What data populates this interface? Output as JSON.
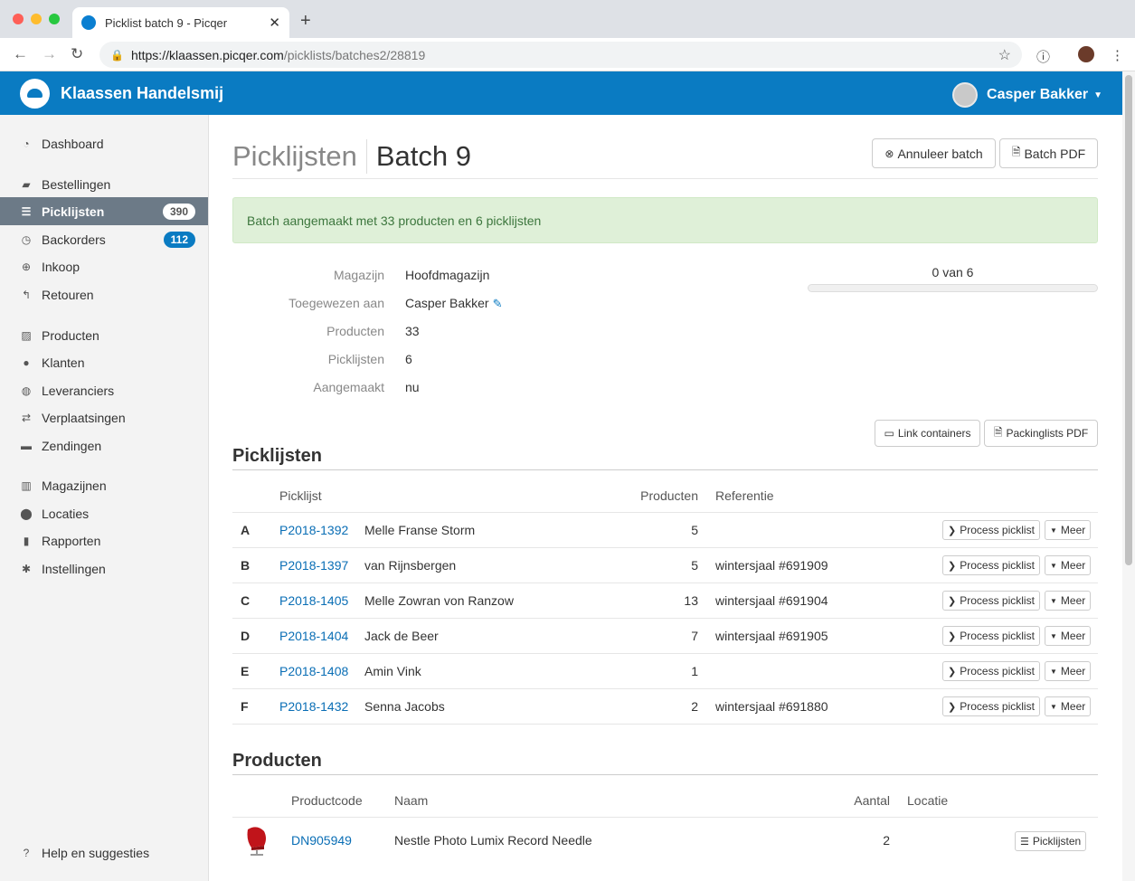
{
  "browser": {
    "tab_title": "Picklist batch 9 - Picqer",
    "url_host": "https://klaassen.picqer.com",
    "url_path": "/picklists/batches2/28819"
  },
  "header": {
    "company": "Klaassen Handelsmij",
    "user": "Casper Bakker"
  },
  "sidebar": {
    "items": [
      {
        "label": "Dashboard",
        "icon": "dashboard-icon",
        "glyph": "◔"
      },
      {
        "label": "Bestellingen",
        "icon": "cart-icon",
        "glyph": "▰"
      },
      {
        "label": "Picklijsten",
        "icon": "list-icon",
        "glyph": "☰",
        "badge": "390"
      },
      {
        "label": "Backorders",
        "icon": "clock-icon",
        "glyph": "◷",
        "badge": "112"
      },
      {
        "label": "Inkoop",
        "icon": "arrow-circle-icon",
        "glyph": "⊕"
      },
      {
        "label": "Retouren",
        "icon": "reply-icon",
        "glyph": "↰"
      },
      {
        "label": "Producten",
        "icon": "image-icon",
        "glyph": "▨"
      },
      {
        "label": "Klanten",
        "icon": "users-icon",
        "glyph": "●"
      },
      {
        "label": "Leveranciers",
        "icon": "globe-icon",
        "glyph": "◍"
      },
      {
        "label": "Verplaatsingen",
        "icon": "retweet-icon",
        "glyph": "⇄"
      },
      {
        "label": "Zendingen",
        "icon": "truck-icon",
        "glyph": "▬"
      },
      {
        "label": "Magazijnen",
        "icon": "building-icon",
        "glyph": "▥"
      },
      {
        "label": "Locaties",
        "icon": "map-marker-icon",
        "glyph": "⬤"
      },
      {
        "label": "Rapporten",
        "icon": "bar-chart-icon",
        "glyph": "▮"
      },
      {
        "label": "Instellingen",
        "icon": "cog-icon",
        "glyph": "✱"
      }
    ],
    "help": "Help en suggesties"
  },
  "page": {
    "title_parent": "Picklijsten",
    "title": "Batch 9",
    "cancel_button": "Annuleer batch",
    "pdf_button": "Batch PDF",
    "alert": "Batch aangemaakt met 33 producten en 6 picklijsten",
    "details": [
      {
        "label": "Magazijn",
        "value": "Hoofdmagazijn"
      },
      {
        "label": "Toegewezen aan",
        "value": "Casper Bakker"
      },
      {
        "label": "Producten",
        "value": "33"
      },
      {
        "label": "Picklijsten",
        "value": "6"
      },
      {
        "label": "Aangemaakt",
        "value": "nu"
      }
    ],
    "progress_text": "0 van 6",
    "progress_fraction": 0,
    "link_containers": "Link containers",
    "packinglists_pdf": "Packinglists PDF"
  },
  "picklists": {
    "heading": "Picklijsten",
    "columns": [
      "Picklijst",
      "Producten",
      "Referentie"
    ],
    "process_label": "Process picklist",
    "more_label": "Meer",
    "rows": [
      {
        "letter": "A",
        "id": "P2018-1392",
        "name": "Melle Franse Storm",
        "products": "5",
        "reference": ""
      },
      {
        "letter": "B",
        "id": "P2018-1397",
        "name": "van Rijnsbergen",
        "products": "5",
        "reference": "wintersjaal #691909"
      },
      {
        "letter": "C",
        "id": "P2018-1405",
        "name": "Melle Zowran von Ranzow",
        "products": "13",
        "reference": "wintersjaal #691904"
      },
      {
        "letter": "D",
        "id": "P2018-1404",
        "name": "Jack de Beer",
        "products": "7",
        "reference": "wintersjaal #691905"
      },
      {
        "letter": "E",
        "id": "P2018-1408",
        "name": "Amin Vink",
        "products": "1",
        "reference": ""
      },
      {
        "letter": "F",
        "id": "P2018-1432",
        "name": "Senna Jacobs",
        "products": "2",
        "reference": "wintersjaal #691880"
      }
    ]
  },
  "products": {
    "heading": "Producten",
    "columns": [
      "Productcode",
      "Naam",
      "Aantal",
      "Locatie"
    ],
    "button_label": "Picklijsten",
    "rows": [
      {
        "code": "DN905949",
        "name": "Nestle Photo Lumix Record Needle",
        "amount": "2",
        "location": ""
      }
    ]
  }
}
